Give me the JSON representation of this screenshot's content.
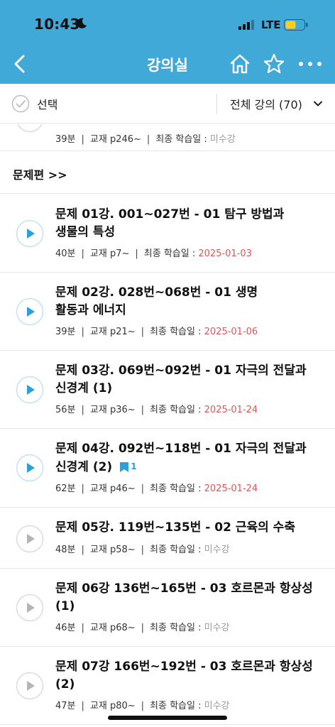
{
  "status": {
    "time": "10:43",
    "carrier": "LTE"
  },
  "nav": {
    "title": "강의실"
  },
  "toolbar": {
    "select_label": "선택",
    "filter_label": "전체 강의 (70)"
  },
  "partial_row": {
    "duration": "39분",
    "book": "교재 p246~",
    "last_label": "최종 학습일 :",
    "last_value": "미수강"
  },
  "section": {
    "title": "문제편 >>"
  },
  "lectures": [
    {
      "title_lines": [
        "문제 01강. 001~027번 - 01 탐구 방법과",
        "생물의 특성"
      ],
      "duration": "40분",
      "book": "교재 p7~",
      "last_label": "최종 학습일 :",
      "last_value": "2025-01-03",
      "watched": true
    },
    {
      "title_lines": [
        "문제 02강. 028번~068번 - 01 생명",
        "활동과 에너지"
      ],
      "duration": "39분",
      "book": "교재 p21~",
      "last_label": "최종 학습일 :",
      "last_value": "2025-01-06",
      "watched": true
    },
    {
      "title_lines": [
        "문제 03강. 069번~092번 - 01 자극의 전달과",
        "신경계 (1)"
      ],
      "duration": "56분",
      "book": "교재 p36~",
      "last_label": "최종 학습일 :",
      "last_value": "2025-01-24",
      "watched": true
    },
    {
      "title_lines": [
        "문제 04강. 092번~118번 - 01 자극의 전달과",
        "신경계 (2)"
      ],
      "bookmark_count": "1",
      "duration": "62분",
      "book": "교재 p46~",
      "last_label": "최종 학습일 :",
      "last_value": "2025-01-24",
      "watched": true
    },
    {
      "title_lines": [
        "문제 05강. 119번~135번 - 02 근육의 수축"
      ],
      "duration": "48분",
      "book": "교재 p58~",
      "last_label": "최종 학습일 :",
      "last_value": "미수강",
      "watched": false
    },
    {
      "title_lines": [
        "문제 06강 136번~165번 - 03 호르몬과 항상성",
        "(1)"
      ],
      "duration": "46분",
      "book": "교재 p68~",
      "last_label": "최종 학습일 :",
      "last_value": "미수강",
      "watched": false
    },
    {
      "title_lines": [
        "문제 07강 166번~192번 - 03 호르몬과 항상성",
        "(2)"
      ],
      "duration": "47분",
      "book": "교재 p80~",
      "last_label": "최종 학습일 :",
      "last_value": "미수강",
      "watched": false
    }
  ],
  "colors": {
    "header": "#41a9d8",
    "play_active": "#2e9fd8",
    "play_inactive": "#b5b5b5",
    "date_watched": "#e05555",
    "date_unwatched": "#9a9a9a"
  },
  "icons": {
    "back": "chevron-left-icon",
    "home": "home-icon",
    "favorite": "star-icon",
    "more": "more-dots-icon",
    "select": "check-circle-icon",
    "filter": "chevron-down-icon",
    "play": "play-icon",
    "bookmark": "bookmark-icon"
  }
}
